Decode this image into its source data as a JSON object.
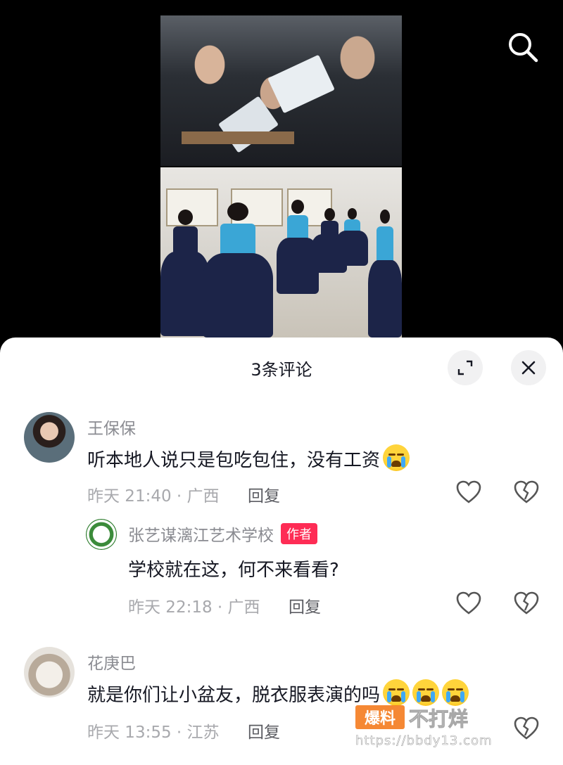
{
  "header": {
    "search_icon": "search-icon"
  },
  "sheet": {
    "title": "3条评论",
    "expand_icon": "expand-icon",
    "close_icon": "close-icon"
  },
  "comments": [
    {
      "username": "王保保",
      "text": "听本地人说只是包吃包住，没有工资",
      "emoji_count": 1,
      "meta": "昨天 21:40 · 广西",
      "reply_label": "回复"
    },
    {
      "username": "张艺谋漓江艺术学校",
      "badge": "作者",
      "text": "学校就在这，何不来看看?",
      "meta": "昨天 22:18 · 广西",
      "reply_label": "回复"
    },
    {
      "username": "花庚巴",
      "text": "就是你们让小盆友，脱衣服表演的吗",
      "emoji_count": 3,
      "meta": "昨天 13:55 · 江苏",
      "reply_label": "回复"
    }
  ],
  "watermark": {
    "box": "爆料",
    "text": "不打烊",
    "url": "https://bbdy13.com"
  },
  "colors": {
    "accent": "#fe2c55",
    "text_primary": "#161823",
    "text_secondary": "#8a8b91"
  }
}
